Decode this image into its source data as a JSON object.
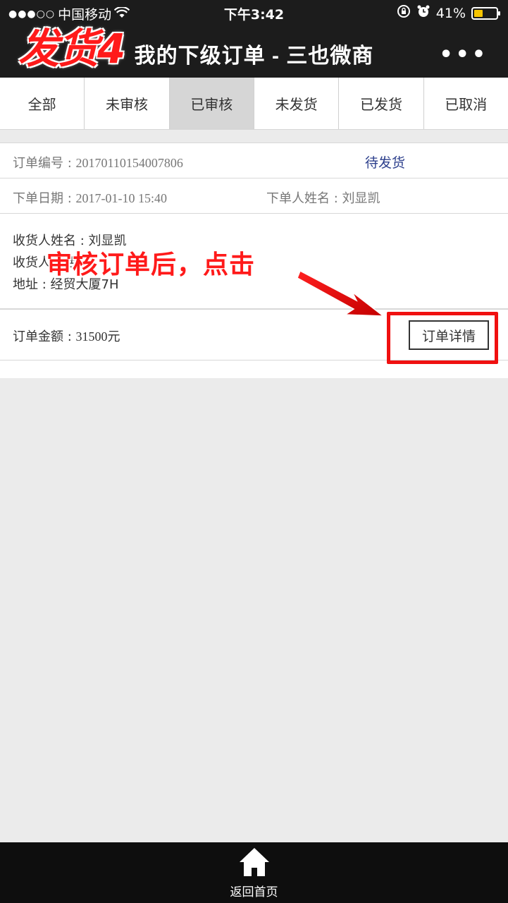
{
  "status_bar": {
    "signal": "●●●○○",
    "carrier": "中国移动",
    "time": "下午3:42",
    "battery_percent": "41%",
    "wifi_icon": "wifi-icon",
    "battery_level": 0.41
  },
  "nav": {
    "title": "我的下级订单 - 三也微商",
    "more": "•••",
    "overlay_step": "发货4"
  },
  "tabs": [
    {
      "label": "全部",
      "active": false
    },
    {
      "label": "未审核",
      "active": false
    },
    {
      "label": "已审核",
      "active": true
    },
    {
      "label": "未发货",
      "active": false
    },
    {
      "label": "已发货",
      "active": false
    },
    {
      "label": "已取消",
      "active": false
    }
  ],
  "order": {
    "number_label": "订单编号 : ",
    "number": "20170110154007806",
    "status": "待发货",
    "date_label": "下单日期 : ",
    "date": "2017-01-10 15:40",
    "buyer_label": "下单人姓名 : 刘显凯",
    "receiver_name": "收货人姓名 : 刘显凯",
    "receiver_phone": "收货人电话 : ",
    "address": "地址 : 经贸大厦7H",
    "amount_label": "订单金额 : ",
    "amount": "31500元",
    "detail_button": "订单详情"
  },
  "annotation": {
    "text": "审核订单后，点击",
    "color": "#ff1a1a"
  },
  "bottom": {
    "home_label": "返回首页",
    "home_icon": "home-icon"
  }
}
